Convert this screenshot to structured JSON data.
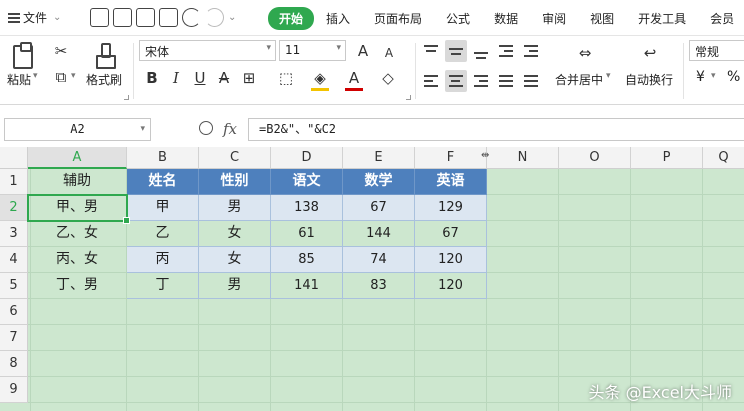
{
  "menubar": {
    "file_label": "文件",
    "tabs": [
      "开始",
      "插入",
      "页面布局",
      "公式",
      "数据",
      "审阅",
      "视图",
      "开发工具",
      "会员"
    ]
  },
  "ribbon": {
    "paste_label": "粘贴",
    "format_painter_label": "格式刷",
    "font_name": "宋体",
    "font_size": "11",
    "bold": "B",
    "italic": "I",
    "underline": "U",
    "strikethrough": "A",
    "font_color_glyph": "A",
    "merge_label": "合并居中",
    "wrap_label": "自动换行",
    "number_format": "常规",
    "currency_symbol": "¥",
    "percent_symbol": "%",
    "font_grow": "A",
    "font_shrink": "A"
  },
  "formula_bar": {
    "name_box": "A2",
    "fx_label": "fx",
    "formula": "=B2&\"、\"&C2"
  },
  "columns": [
    "A",
    "B",
    "C",
    "D",
    "E",
    "F",
    "N",
    "O",
    "P",
    "Q"
  ],
  "rows": [
    "1",
    "2",
    "3",
    "4",
    "5",
    "6",
    "7",
    "8",
    "9"
  ],
  "table": {
    "headers": [
      "辅助",
      "姓名",
      "性别",
      "语文",
      "数学",
      "英语"
    ],
    "data": [
      [
        "甲、男",
        "甲",
        "男",
        "138",
        "67",
        "129"
      ],
      [
        "乙、女",
        "乙",
        "女",
        "61",
        "144",
        "67"
      ],
      [
        "丙、女",
        "丙",
        "女",
        "85",
        "74",
        "120"
      ],
      [
        "丁、男",
        "丁",
        "男",
        "141",
        "83",
        "120"
      ]
    ]
  },
  "watermark": "头条 @Excel大斗师",
  "colors": {
    "accent": "#2fa84f",
    "table_header": "#4e80bd",
    "band": "#dce6f1",
    "sheet_bg": "#cde7cf"
  }
}
